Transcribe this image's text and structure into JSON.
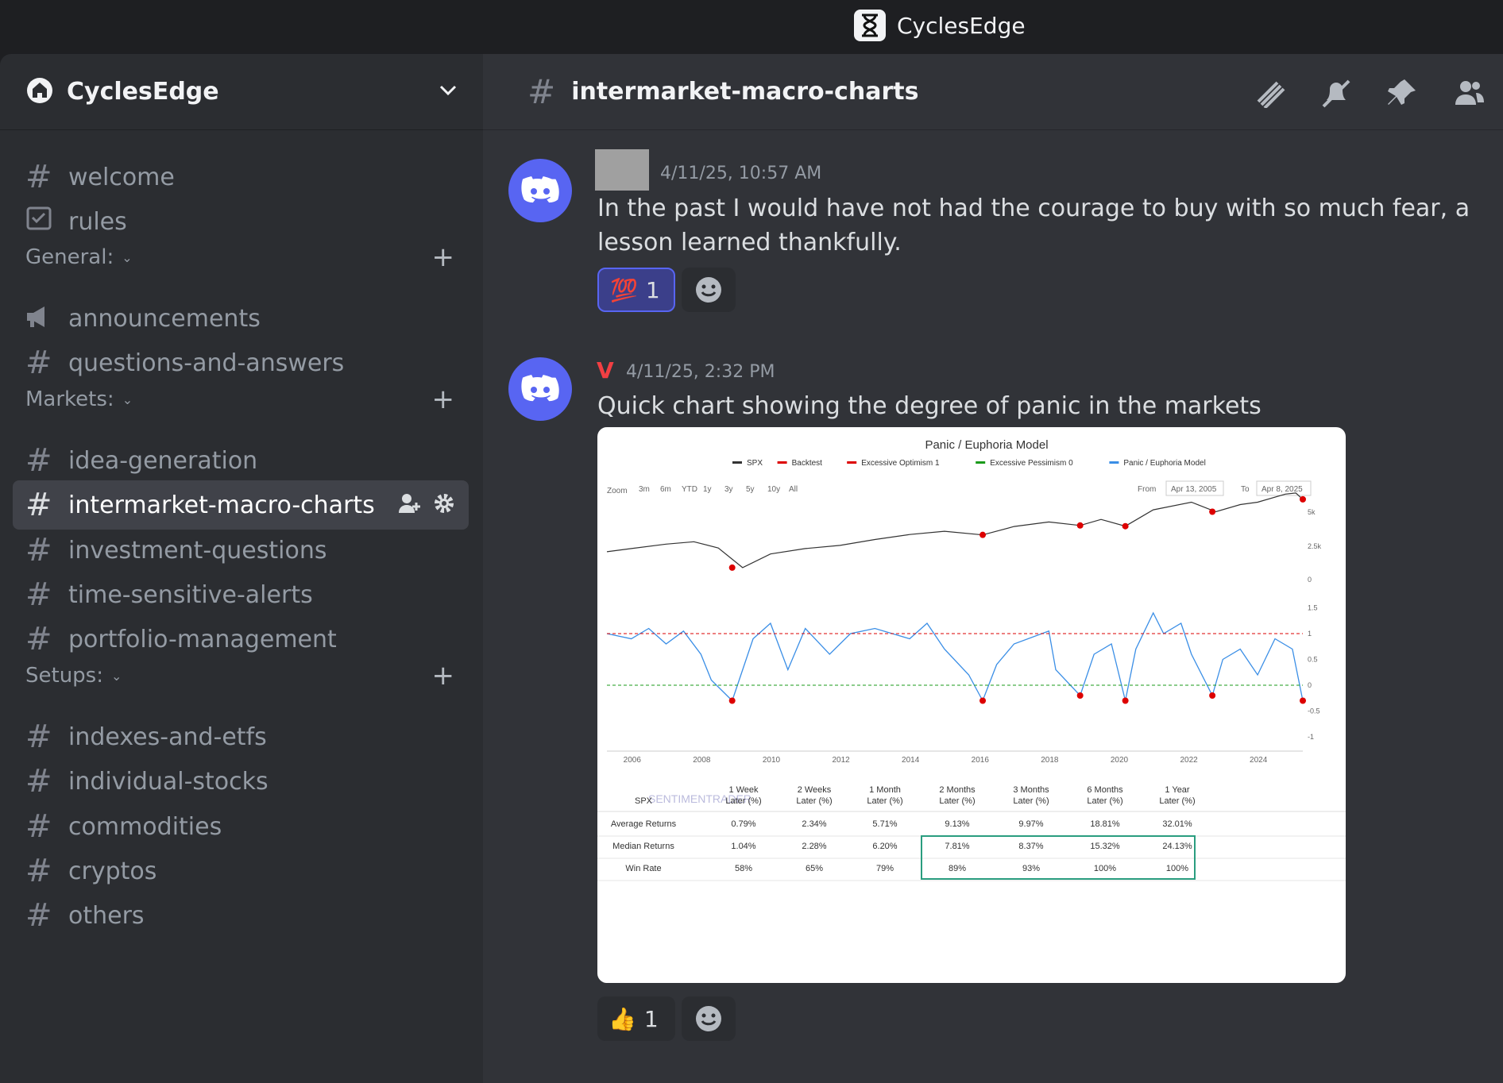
{
  "app": {
    "title": "CyclesEdge"
  },
  "server": {
    "name": "CyclesEdge"
  },
  "sidebar": {
    "top_channels": [
      {
        "name": "welcome",
        "icon": "hash-icon"
      },
      {
        "name": "rules",
        "icon": "rules-icon"
      }
    ],
    "categories": [
      {
        "name": "General:",
        "channels": [
          "announcements",
          "questions-and-answers"
        ]
      },
      {
        "name": "Markets:",
        "channels": [
          "idea-generation",
          "intermarket-macro-charts",
          "investment-questions",
          "time-sensitive-alerts",
          "portfolio-management"
        ]
      },
      {
        "name": "Setups:",
        "channels": [
          "indexes-and-etfs",
          "individual-stocks",
          "commodities",
          "cryptos",
          "others"
        ]
      }
    ],
    "active_channel": "intermarket-macro-charts"
  },
  "channel": {
    "name": "intermarket-macro-charts"
  },
  "messages": [
    {
      "author": "",
      "timestamp": "4/11/25, 10:57 AM",
      "text": "In the past I would have not had the courage to buy with so much fear, a lesson learned thankfully.",
      "reactions": [
        {
          "emoji": "💯",
          "count": "1",
          "selected": true
        }
      ]
    },
    {
      "author": "V",
      "author_color": "#f23f43",
      "timestamp": "4/11/25, 2:32 PM",
      "text": "Quick chart showing the degree of panic in the markets",
      "reactions": [
        {
          "emoji": "👍",
          "count": "1",
          "selected": false
        }
      ]
    }
  ],
  "attachment_chart": {
    "title": "Panic / Euphoria Model",
    "legend": [
      "SPX",
      "Backtest",
      "Excessive Optimism 1",
      "Excessive Pessimism 0",
      "Panic / Euphoria Model"
    ],
    "zoom_label": "Zoom",
    "zoom_buttons": [
      "3m",
      "6m",
      "YTD",
      "1y",
      "3y",
      "5y",
      "10y",
      "All"
    ],
    "from_label": "From",
    "from_value": "Apr 13, 2005",
    "to_label": "To",
    "to_value": "Apr 8, 2025",
    "watermark": "SENTIMENTRADER",
    "x_ticks": [
      "2006",
      "2008",
      "2010",
      "2012",
      "2014",
      "2016",
      "2018",
      "2020",
      "2022",
      "2024"
    ],
    "top_y_ticks": [
      "5k",
      "2.5k",
      "0"
    ],
    "bottom_y_ticks": [
      "1.5",
      "1",
      "0.5",
      "0",
      "-0.5",
      "-1"
    ],
    "table": {
      "header": [
        "SPX",
        "1 Week Later (%)",
        "2 Weeks Later (%)",
        "1 Month Later (%)",
        "2 Months Later (%)",
        "3 Months Later (%)",
        "6 Months Later (%)",
        "1 Year Later (%)"
      ],
      "rows": [
        [
          "Average Returns",
          "0.79%",
          "2.34%",
          "5.71%",
          "9.13%",
          "9.97%",
          "18.81%",
          "32.01%"
        ],
        [
          "Median Returns",
          "1.04%",
          "2.28%",
          "6.20%",
          "7.81%",
          "8.37%",
          "15.32%",
          "24.13%"
        ],
        [
          "Win Rate",
          "58%",
          "65%",
          "79%",
          "89%",
          "93%",
          "100%",
          "100%"
        ]
      ]
    }
  },
  "chart_data": {
    "type": "line",
    "title": "Panic / Euphoria Model",
    "x_range": [
      2005.3,
      2025.3
    ],
    "series": [
      {
        "name": "SPX",
        "x": [
          2005.3,
          2006,
          2007,
          2007.8,
          2008.5,
          2009.2,
          2010,
          2011,
          2012,
          2013,
          2014,
          2015,
          2016.1,
          2017,
          2018,
          2018.9,
          2019.5,
          2020.2,
          2021,
          2022.1,
          2022.8,
          2023.5,
          2024,
          2024.8,
          2025.1,
          2025.3
        ],
        "values": [
          1170,
          1280,
          1450,
          1550,
          1300,
          750,
          1100,
          1280,
          1400,
          1650,
          1900,
          2080,
          1880,
          2380,
          2700,
          2450,
          2900,
          2400,
          3800,
          4700,
          3600,
          4400,
          4700,
          5900,
          6100,
          5100
        ]
      },
      {
        "name": "Panic / Euphoria Model",
        "x": [
          2005.3,
          2006,
          2006.5,
          2007,
          2007.5,
          2008,
          2008.3,
          2008.9,
          2009.5,
          2010,
          2010.5,
          2011,
          2011.7,
          2012.3,
          2013,
          2014,
          2014.5,
          2015,
          2015.7,
          2016.1,
          2016.5,
          2017,
          2018,
          2018.2,
          2018.9,
          2019.3,
          2019.8,
          2020.2,
          2020.5,
          2021,
          2021.3,
          2021.8,
          2022.1,
          2022.7,
          2023,
          2023.5,
          2024,
          2024.5,
          2025,
          2025.3
        ],
        "values": [
          1.0,
          0.9,
          1.1,
          0.8,
          1.05,
          0.6,
          0.1,
          -0.3,
          0.9,
          1.2,
          0.3,
          1.1,
          0.6,
          1.0,
          1.1,
          0.9,
          1.2,
          0.7,
          0.2,
          -0.3,
          0.4,
          0.8,
          1.05,
          0.3,
          -0.2,
          0.6,
          0.8,
          -0.3,
          0.7,
          1.4,
          1.0,
          1.2,
          0.6,
          -0.2,
          0.5,
          0.7,
          0.2,
          0.9,
          0.7,
          -0.3
        ]
      }
    ],
    "reference_lines": {
      "Excessive Optimism 1": 1,
      "Excessive Pessimism 0": 0
    }
  }
}
